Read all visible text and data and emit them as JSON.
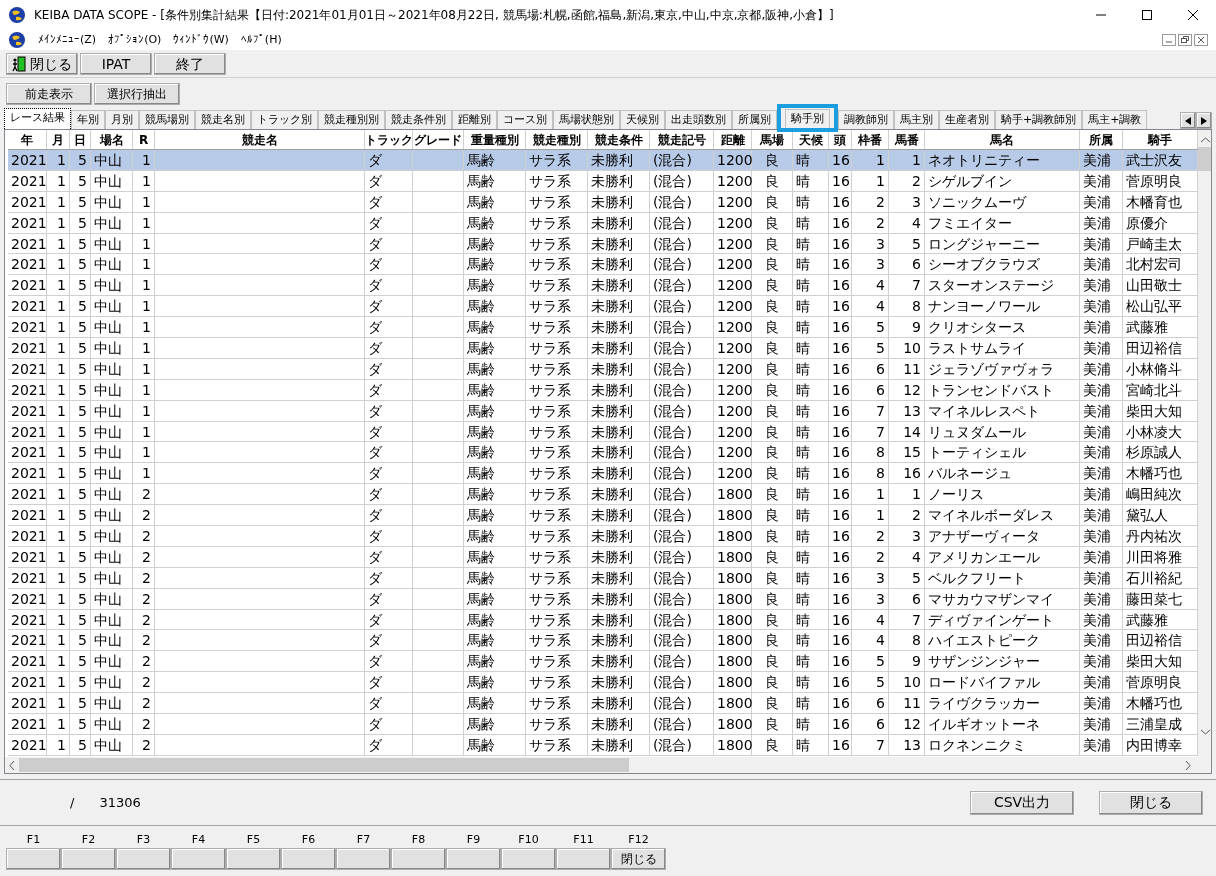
{
  "window": {
    "title": "KEIBA DATA SCOPE - [条件別集計結果【日付:2021年01月01日～2021年08月22日, 競馬場:札幌,函館,福島,新潟,東京,中山,中京,京都,阪神,小倉】]"
  },
  "menu": [
    "ﾒｲﾝﾒﾆｭｰ(Z)",
    "ｵﾌﾟｼｮﾝ(O)",
    "ｳｨﾝﾄﾞｳ(W)",
    "ﾍﾙﾌﾟ(H)"
  ],
  "toolbar": [
    {
      "label": "閉じる",
      "kind": "exit"
    },
    {
      "label": "IPAT",
      "kind": "plain"
    },
    {
      "label": "終了",
      "kind": "plain"
    }
  ],
  "toolbar2": [
    "前走表示",
    "選択行抽出"
  ],
  "tabs": [
    {
      "label": "レース結果",
      "selected": true,
      "highlight": false
    },
    {
      "label": "年別",
      "selected": false,
      "highlight": false
    },
    {
      "label": "月別",
      "selected": false,
      "highlight": false
    },
    {
      "label": "競馬場別",
      "selected": false,
      "highlight": false
    },
    {
      "label": "競走名別",
      "selected": false,
      "highlight": false
    },
    {
      "label": "トラック別",
      "selected": false,
      "highlight": false
    },
    {
      "label": "競走種別別",
      "selected": false,
      "highlight": false
    },
    {
      "label": "競走条件別",
      "selected": false,
      "highlight": false
    },
    {
      "label": "距離別",
      "selected": false,
      "highlight": false
    },
    {
      "label": "コース別",
      "selected": false,
      "highlight": false
    },
    {
      "label": "馬場状態別",
      "selected": false,
      "highlight": false
    },
    {
      "label": "天候別",
      "selected": false,
      "highlight": false
    },
    {
      "label": "出走頭数別",
      "selected": false,
      "highlight": false
    },
    {
      "label": "所属別",
      "selected": false,
      "highlight": false
    },
    {
      "label": "騎手別",
      "selected": false,
      "highlight": true
    },
    {
      "label": "調教師別",
      "selected": false,
      "highlight": false
    },
    {
      "label": "馬主別",
      "selected": false,
      "highlight": false
    },
    {
      "label": "生産者別",
      "selected": false,
      "highlight": false
    },
    {
      "label": "騎手+調教師別",
      "selected": false,
      "highlight": false
    },
    {
      "label": "馬主+調教",
      "selected": false,
      "highlight": false
    }
  ],
  "table": {
    "columns": [
      "年",
      "月",
      "日",
      "場名",
      "R",
      "競走名",
      "トラック",
      "グレード",
      "重量種別",
      "競走種別",
      "競走条件",
      "競走記号",
      "距離",
      "馬場",
      "天候",
      "頭",
      "枠番",
      "馬番",
      "馬名",
      "所属",
      "騎手"
    ],
    "rows": [
      {
        "selected": true,
        "cells": [
          "2021",
          "1",
          "5",
          "中山",
          "1",
          null,
          "ダ",
          null,
          "馬齢",
          "サラ系",
          "未勝利",
          "(混合)",
          "1200",
          "良",
          "晴",
          "16",
          "1",
          "1",
          "ネオトリニティー",
          "美浦",
          "武士沢友"
        ]
      },
      {
        "selected": false,
        "cells": [
          "2021",
          "1",
          "5",
          "中山",
          "1",
          null,
          "ダ",
          null,
          "馬齢",
          "サラ系",
          "未勝利",
          "(混合)",
          "1200",
          "良",
          "晴",
          "16",
          "1",
          "2",
          "シゲルブイン",
          "美浦",
          "菅原明良"
        ]
      },
      {
        "selected": false,
        "cells": [
          "2021",
          "1",
          "5",
          "中山",
          "1",
          null,
          "ダ",
          null,
          "馬齢",
          "サラ系",
          "未勝利",
          "(混合)",
          "1200",
          "良",
          "晴",
          "16",
          "2",
          "3",
          "ソニックムーヴ",
          "美浦",
          "木幡育也"
        ]
      },
      {
        "selected": false,
        "cells": [
          "2021",
          "1",
          "5",
          "中山",
          "1",
          null,
          "ダ",
          null,
          "馬齢",
          "サラ系",
          "未勝利",
          "(混合)",
          "1200",
          "良",
          "晴",
          "16",
          "2",
          "4",
          "フミエイター",
          "美浦",
          "原優介"
        ]
      },
      {
        "selected": false,
        "cells": [
          "2021",
          "1",
          "5",
          "中山",
          "1",
          null,
          "ダ",
          null,
          "馬齢",
          "サラ系",
          "未勝利",
          "(混合)",
          "1200",
          "良",
          "晴",
          "16",
          "3",
          "5",
          "ロングジャーニー",
          "美浦",
          "戸崎圭太"
        ]
      },
      {
        "selected": false,
        "cells": [
          "2021",
          "1",
          "5",
          "中山",
          "1",
          null,
          "ダ",
          null,
          "馬齢",
          "サラ系",
          "未勝利",
          "(混合)",
          "1200",
          "良",
          "晴",
          "16",
          "3",
          "6",
          "シーオブクラウズ",
          "美浦",
          "北村宏司"
        ]
      },
      {
        "selected": false,
        "cells": [
          "2021",
          "1",
          "5",
          "中山",
          "1",
          null,
          "ダ",
          null,
          "馬齢",
          "サラ系",
          "未勝利",
          "(混合)",
          "1200",
          "良",
          "晴",
          "16",
          "4",
          "7",
          "スターオンステージ",
          "美浦",
          "山田敬士"
        ]
      },
      {
        "selected": false,
        "cells": [
          "2021",
          "1",
          "5",
          "中山",
          "1",
          null,
          "ダ",
          null,
          "馬齢",
          "サラ系",
          "未勝利",
          "(混合)",
          "1200",
          "良",
          "晴",
          "16",
          "4",
          "8",
          "ナンヨーノワール",
          "美浦",
          "松山弘平"
        ]
      },
      {
        "selected": false,
        "cells": [
          "2021",
          "1",
          "5",
          "中山",
          "1",
          null,
          "ダ",
          null,
          "馬齢",
          "サラ系",
          "未勝利",
          "(混合)",
          "1200",
          "良",
          "晴",
          "16",
          "5",
          "9",
          "クリオシタース",
          "美浦",
          "武藤雅"
        ]
      },
      {
        "selected": false,
        "cells": [
          "2021",
          "1",
          "5",
          "中山",
          "1",
          null,
          "ダ",
          null,
          "馬齢",
          "サラ系",
          "未勝利",
          "(混合)",
          "1200",
          "良",
          "晴",
          "16",
          "5",
          "10",
          "ラストサムライ",
          "美浦",
          "田辺裕信"
        ]
      },
      {
        "selected": false,
        "cells": [
          "2021",
          "1",
          "5",
          "中山",
          "1",
          null,
          "ダ",
          null,
          "馬齢",
          "サラ系",
          "未勝利",
          "(混合)",
          "1200",
          "良",
          "晴",
          "16",
          "6",
          "11",
          "ジェラゾヴァヴォラ",
          "美浦",
          "小林脩斗"
        ]
      },
      {
        "selected": false,
        "cells": [
          "2021",
          "1",
          "5",
          "中山",
          "1",
          null,
          "ダ",
          null,
          "馬齢",
          "サラ系",
          "未勝利",
          "(混合)",
          "1200",
          "良",
          "晴",
          "16",
          "6",
          "12",
          "トランセンドバスト",
          "美浦",
          "宮崎北斗"
        ]
      },
      {
        "selected": false,
        "cells": [
          "2021",
          "1",
          "5",
          "中山",
          "1",
          null,
          "ダ",
          null,
          "馬齢",
          "サラ系",
          "未勝利",
          "(混合)",
          "1200",
          "良",
          "晴",
          "16",
          "7",
          "13",
          "マイネルレスペト",
          "美浦",
          "柴田大知"
        ]
      },
      {
        "selected": false,
        "cells": [
          "2021",
          "1",
          "5",
          "中山",
          "1",
          null,
          "ダ",
          null,
          "馬齢",
          "サラ系",
          "未勝利",
          "(混合)",
          "1200",
          "良",
          "晴",
          "16",
          "7",
          "14",
          "リュヌダムール",
          "美浦",
          "小林凌大"
        ]
      },
      {
        "selected": false,
        "cells": [
          "2021",
          "1",
          "5",
          "中山",
          "1",
          null,
          "ダ",
          null,
          "馬齢",
          "サラ系",
          "未勝利",
          "(混合)",
          "1200",
          "良",
          "晴",
          "16",
          "8",
          "15",
          "トーティシェル",
          "美浦",
          "杉原誠人"
        ]
      },
      {
        "selected": false,
        "cells": [
          "2021",
          "1",
          "5",
          "中山",
          "1",
          null,
          "ダ",
          null,
          "馬齢",
          "サラ系",
          "未勝利",
          "(混合)",
          "1200",
          "良",
          "晴",
          "16",
          "8",
          "16",
          "バルネージュ",
          "美浦",
          "木幡巧也"
        ]
      },
      {
        "selected": false,
        "cells": [
          "2021",
          "1",
          "5",
          "中山",
          "2",
          null,
          "ダ",
          null,
          "馬齢",
          "サラ系",
          "未勝利",
          "(混合)",
          "1800",
          "良",
          "晴",
          "16",
          "1",
          "1",
          "ノーリス",
          "美浦",
          "嶋田純次"
        ]
      },
      {
        "selected": false,
        "cells": [
          "2021",
          "1",
          "5",
          "中山",
          "2",
          null,
          "ダ",
          null,
          "馬齢",
          "サラ系",
          "未勝利",
          "(混合)",
          "1800",
          "良",
          "晴",
          "16",
          "1",
          "2",
          "マイネルボーダレス",
          "美浦",
          "黛弘人"
        ]
      },
      {
        "selected": false,
        "cells": [
          "2021",
          "1",
          "5",
          "中山",
          "2",
          null,
          "ダ",
          null,
          "馬齢",
          "サラ系",
          "未勝利",
          "(混合)",
          "1800",
          "良",
          "晴",
          "16",
          "2",
          "3",
          "アナザーヴィータ",
          "美浦",
          "丹内祐次"
        ]
      },
      {
        "selected": false,
        "cells": [
          "2021",
          "1",
          "5",
          "中山",
          "2",
          null,
          "ダ",
          null,
          "馬齢",
          "サラ系",
          "未勝利",
          "(混合)",
          "1800",
          "良",
          "晴",
          "16",
          "2",
          "4",
          "アメリカンエール",
          "美浦",
          "川田将雅"
        ]
      },
      {
        "selected": false,
        "cells": [
          "2021",
          "1",
          "5",
          "中山",
          "2",
          null,
          "ダ",
          null,
          "馬齢",
          "サラ系",
          "未勝利",
          "(混合)",
          "1800",
          "良",
          "晴",
          "16",
          "3",
          "5",
          "ベルクフリート",
          "美浦",
          "石川裕紀"
        ]
      },
      {
        "selected": false,
        "cells": [
          "2021",
          "1",
          "5",
          "中山",
          "2",
          null,
          "ダ",
          null,
          "馬齢",
          "サラ系",
          "未勝利",
          "(混合)",
          "1800",
          "良",
          "晴",
          "16",
          "3",
          "6",
          "マサカウマザンマイ",
          "美浦",
          "藤田菜七"
        ]
      },
      {
        "selected": false,
        "cells": [
          "2021",
          "1",
          "5",
          "中山",
          "2",
          null,
          "ダ",
          null,
          "馬齢",
          "サラ系",
          "未勝利",
          "(混合)",
          "1800",
          "良",
          "晴",
          "16",
          "4",
          "7",
          "ディヴァインゲート",
          "美浦",
          "武藤雅"
        ]
      },
      {
        "selected": false,
        "cells": [
          "2021",
          "1",
          "5",
          "中山",
          "2",
          null,
          "ダ",
          null,
          "馬齢",
          "サラ系",
          "未勝利",
          "(混合)",
          "1800",
          "良",
          "晴",
          "16",
          "4",
          "8",
          "ハイエストピーク",
          "美浦",
          "田辺裕信"
        ]
      },
      {
        "selected": false,
        "cells": [
          "2021",
          "1",
          "5",
          "中山",
          "2",
          null,
          "ダ",
          null,
          "馬齢",
          "サラ系",
          "未勝利",
          "(混合)",
          "1800",
          "良",
          "晴",
          "16",
          "5",
          "9",
          "サザンジンジャー",
          "美浦",
          "柴田大知"
        ]
      },
      {
        "selected": false,
        "cells": [
          "2021",
          "1",
          "5",
          "中山",
          "2",
          null,
          "ダ",
          null,
          "馬齢",
          "サラ系",
          "未勝利",
          "(混合)",
          "1800",
          "良",
          "晴",
          "16",
          "5",
          "10",
          "ロードバイファル",
          "美浦",
          "菅原明良"
        ]
      },
      {
        "selected": false,
        "cells": [
          "2021",
          "1",
          "5",
          "中山",
          "2",
          null,
          "ダ",
          null,
          "馬齢",
          "サラ系",
          "未勝利",
          "(混合)",
          "1800",
          "良",
          "晴",
          "16",
          "6",
          "11",
          "ライヴクラッカー",
          "美浦",
          "木幡巧也"
        ]
      },
      {
        "selected": false,
        "cells": [
          "2021",
          "1",
          "5",
          "中山",
          "2",
          null,
          "ダ",
          null,
          "馬齢",
          "サラ系",
          "未勝利",
          "(混合)",
          "1800",
          "良",
          "晴",
          "16",
          "6",
          "12",
          "イルギオットーネ",
          "美浦",
          "三浦皇成"
        ]
      },
      {
        "selected": false,
        "cells": [
          "2021",
          "1",
          "5",
          "中山",
          "2",
          null,
          "ダ",
          null,
          "馬齢",
          "サラ系",
          "未勝利",
          "(混合)",
          "1800",
          "良",
          "晴",
          "16",
          "7",
          "13",
          "ロクネンニクミ",
          "美浦",
          "内田博幸"
        ]
      }
    ]
  },
  "status": {
    "separator": "/",
    "total": "31306"
  },
  "buttons": [
    "CSV出力",
    "閉じる"
  ],
  "function_keys": [
    {
      "key": "F1"
    },
    {
      "key": "F2"
    },
    {
      "key": "F3"
    },
    {
      "key": "F4"
    },
    {
      "key": "F5"
    },
    {
      "key": "F6"
    },
    {
      "key": "F7"
    },
    {
      "key": "F8"
    },
    {
      "key": "F9"
    },
    {
      "key": "F10"
    },
    {
      "key": "F11"
    },
    {
      "key": "F12",
      "label": "閉じる"
    }
  ]
}
